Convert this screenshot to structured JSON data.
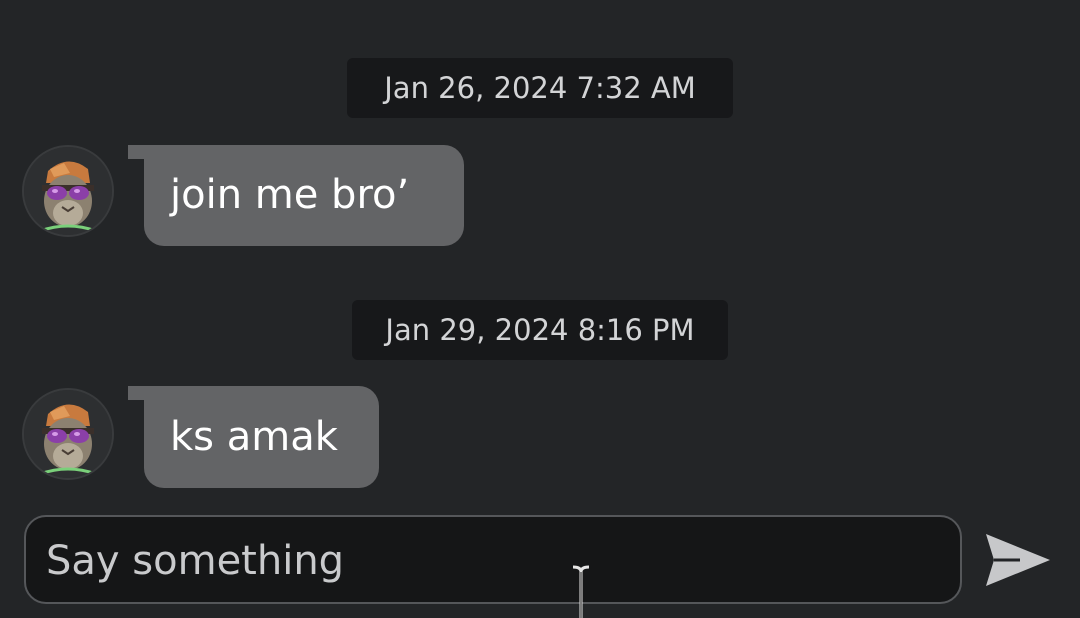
{
  "messages": [
    {
      "timestamp": "Jan 26, 2024 7:32 AM",
      "text": "join me bro’",
      "avatar_icon": "cat-with-sunglasses-avatar-icon"
    },
    {
      "timestamp": "Jan 29, 2024 8:16 PM",
      "text": "ks amak",
      "avatar_icon": "cat-with-sunglasses-avatar-icon"
    }
  ],
  "composer": {
    "placeholder": "Say something",
    "value": "",
    "send_icon": "send-arrow-icon"
  },
  "colors": {
    "background": "#232527",
    "timestamp_bg": "#17181a",
    "bubble": "#636466",
    "input_bg": "#151617",
    "send_icon": "#c7c8ca"
  }
}
